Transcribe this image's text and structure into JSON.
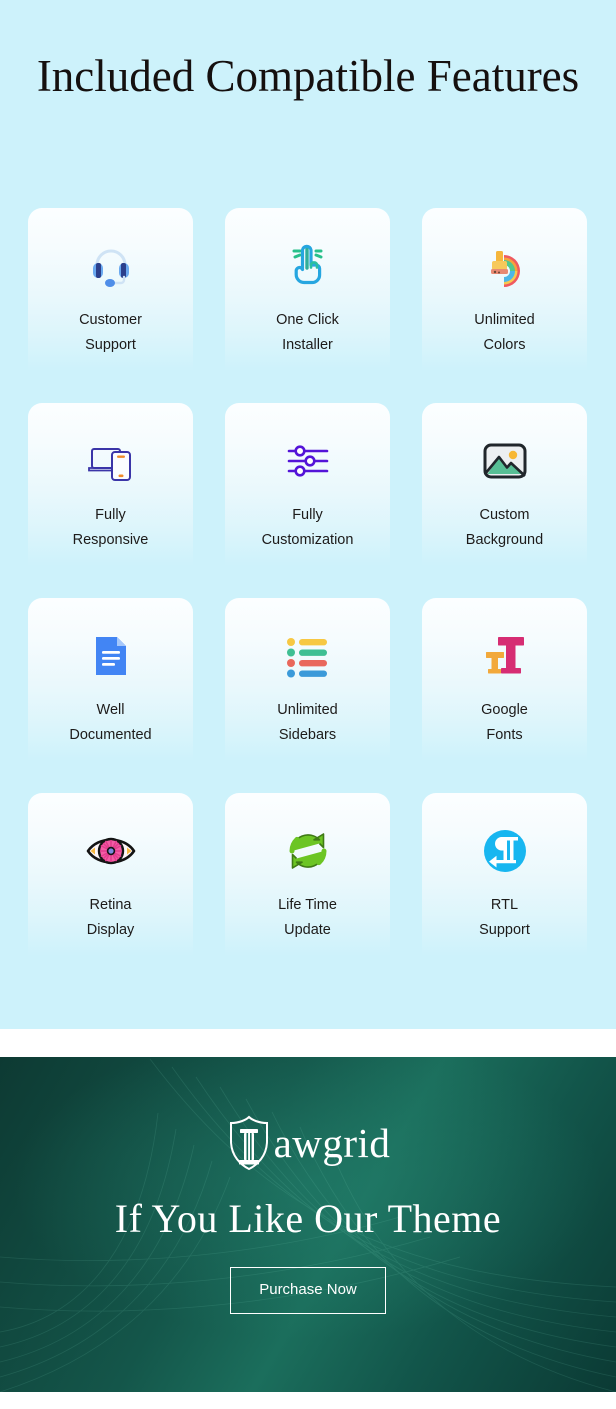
{
  "features": {
    "title": "Included Compatible Features",
    "items": [
      {
        "icon": "headset-icon",
        "label": "Customer\nSupport"
      },
      {
        "icon": "click-hand-icon",
        "label": "One Click\nInstaller"
      },
      {
        "icon": "paint-rainbow-icon",
        "label": "Unlimited\nColors"
      },
      {
        "icon": "devices-icon",
        "label": "Fully\nResponsive"
      },
      {
        "icon": "sliders-icon",
        "label": "Fully\nCustomization"
      },
      {
        "icon": "image-icon",
        "label": "Custom\nBackground"
      },
      {
        "icon": "document-icon",
        "label": "Well\nDocumented"
      },
      {
        "icon": "color-list-icon",
        "label": "Unlimited\nSidebars"
      },
      {
        "icon": "font-tt-icon",
        "label": "Google\nFonts"
      },
      {
        "icon": "eye-icon",
        "label": "Retina\nDisplay"
      },
      {
        "icon": "refresh-cycle-icon",
        "label": "Life Time\nUpdate"
      },
      {
        "icon": "rtl-pilcrow-icon",
        "label": "RTL\nSupport"
      }
    ]
  },
  "cta": {
    "brand_name": "awgrid",
    "brand_mark": "shield-column-logo-icon",
    "heading": "If You Like Our Theme",
    "button_label": "Purchase Now"
  },
  "colors": {
    "section_background": "#cdf2fb",
    "card_top": "#fcfeff",
    "text": "#1d1b1a",
    "cta_dark": "#0d3a33",
    "cta_mid": "#1b6e5c",
    "cta_text": "#ffffff"
  }
}
